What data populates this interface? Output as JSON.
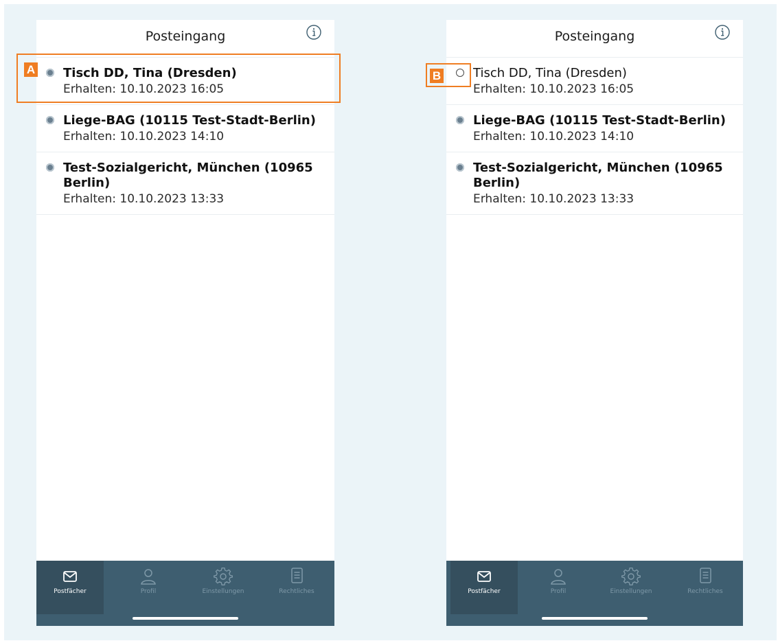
{
  "colors": {
    "accent": "#ef7d22",
    "tabbar": "#3e5e70",
    "background": "#ebf4f8"
  },
  "screens": [
    {
      "header": {
        "title": "Posteingang",
        "info_icon": "info-circle-icon"
      },
      "messages": [
        {
          "sender": "Tisch DD, Tina (Dresden)",
          "received": "Erhalten: 10.10.2023 16:05",
          "unread": true
        },
        {
          "sender": "Liege-BAG (10115 Test-Stadt-Berlin)",
          "received": "Erhalten: 10.10.2023 14:10",
          "unread": true
        },
        {
          "sender": "Test-Sozialgericht, München (10965 Berlin)",
          "received": "Erhalten: 10.10.2023 13:33",
          "unread": true
        }
      ],
      "tabs": [
        {
          "label": "Postfächer",
          "icon": "envelope-icon",
          "active": true
        },
        {
          "label": "Profil",
          "icon": "person-icon",
          "active": false
        },
        {
          "label": "Einstellungen",
          "icon": "gear-icon",
          "active": false
        },
        {
          "label": "Rechtliches",
          "icon": "document-icon",
          "active": false
        }
      ]
    },
    {
      "header": {
        "title": "Posteingang",
        "info_icon": "info-circle-icon"
      },
      "messages": [
        {
          "sender": "Tisch DD, Tina (Dresden)",
          "received": "Erhalten: 10.10.2023 16:05",
          "unread": false
        },
        {
          "sender": "Liege-BAG (10115 Test-Stadt-Berlin)",
          "received": "Erhalten: 10.10.2023 14:10",
          "unread": true
        },
        {
          "sender": "Test-Sozialgericht, München (10965 Berlin)",
          "received": "Erhalten: 10.10.2023 13:33",
          "unread": true
        }
      ],
      "tabs": [
        {
          "label": "Postfächer",
          "icon": "envelope-icon",
          "active": true
        },
        {
          "label": "Profil",
          "icon": "person-icon",
          "active": false
        },
        {
          "label": "Einstellungen",
          "icon": "gear-icon",
          "active": false
        },
        {
          "label": "Rechtliches",
          "icon": "document-icon",
          "active": false
        }
      ]
    }
  ],
  "annotations": {
    "a": "A",
    "b": "B"
  }
}
